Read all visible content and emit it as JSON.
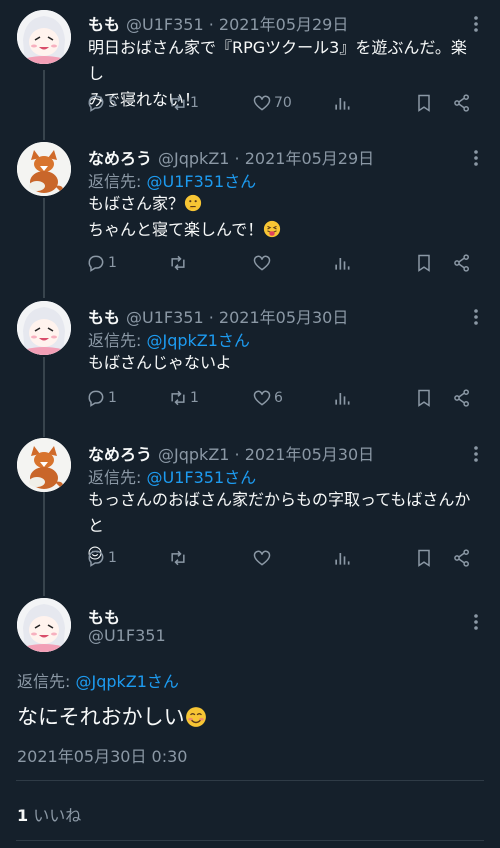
{
  "tweets": [
    {
      "name": "もも",
      "handle": "@U1F351",
      "date": "· 2021年05月29日",
      "reply_label": "",
      "reply_to": "",
      "text_line1": "明日おばさん家で『RPGツクール3』を遊ぶんだ。楽し",
      "text_line2": "みで寝れない！",
      "replies": "5",
      "retweets": "1",
      "likes": "70"
    },
    {
      "name": "なめろう",
      "handle": "@JqpkZ1",
      "date": "· 2021年05月29日",
      "reply_label": "返信先: ",
      "reply_to": "@U1F351さん",
      "text_line1": "もばさん家？",
      "text_line2": "ちゃんと寝て楽しんで！",
      "replies": "1",
      "retweets": "",
      "likes": ""
    },
    {
      "name": "もも",
      "handle": "@U1F351",
      "date": "· 2021年05月30日",
      "reply_label": "返信先: ",
      "reply_to": "@JqpkZ1さん",
      "text_line1": "もばさんじゃないよ",
      "text_line2": "",
      "replies": "1",
      "retweets": "1",
      "likes": "6"
    },
    {
      "name": "なめろう",
      "handle": "@JqpkZ1",
      "date": "· 2021年05月30日",
      "reply_label": "返信先: ",
      "reply_to": "@U1F351さん",
      "text_line1": "もっさんのおばさん家だからもの字取ってもばさんかと",
      "text_line2": "",
      "replies": "1",
      "retweets": "",
      "likes": ""
    }
  ],
  "main": {
    "name": "もも",
    "handle": "@U1F351",
    "reply_label": "返信先: ",
    "reply_to": "@JqpkZ1さん",
    "text": "なにそれおかしい",
    "timestamp": "2021年05月30日 0:30",
    "likes_count": "1",
    "likes_label": "いいね"
  },
  "colors": {
    "background": "#15202b",
    "link": "#1d9bf0",
    "muted": "#8b98a5"
  }
}
